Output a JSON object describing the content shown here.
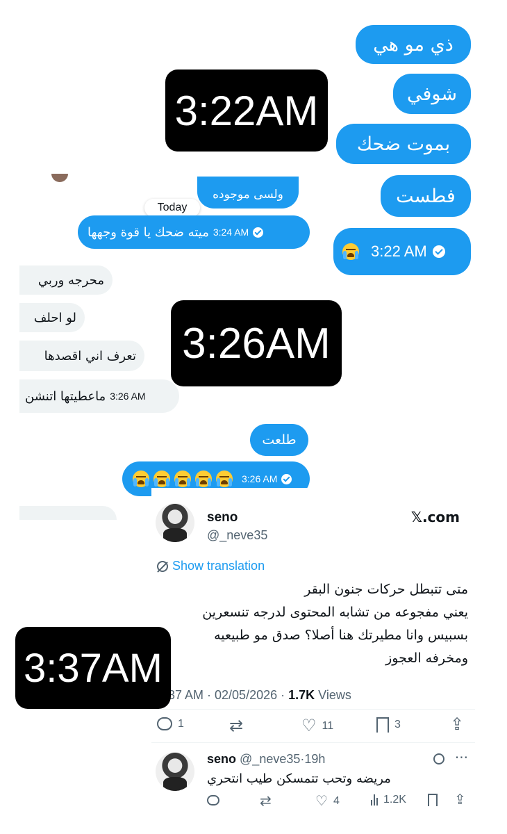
{
  "panel1": {
    "messages": [
      "ذي مو هي",
      "شوفي",
      "بموت ضحك",
      "فطست"
    ],
    "last_time": "3:22 AM",
    "badge": "3:22AM"
  },
  "panel2": {
    "top_partial": "ولسى موجوده",
    "date_label": "Today",
    "out_message": "ميته ضحك يا قوة وجهها",
    "out_time": "3:24 AM",
    "in_messages": [
      "محرجه وربي",
      "لو احلف",
      "تعرف اني اقصدها"
    ],
    "in_last": "ماعطيتها اتنشن",
    "in_last_time": "3:26 AM",
    "out2": "طلعت",
    "emoji_time": "3:26 AM",
    "badge": "3:26AM"
  },
  "tweet": {
    "name": "seno",
    "handle": "@_neve35",
    "brand": "𝕏.com",
    "show_translation": "Show translation",
    "lines": [
      "متى تتبطل حركات جنون البقر",
      "يعني مفجوعه من تشابه المحتوى لدرجه تنسعرين",
      "بسبيس وانا مطيرتك هنا أصلا؟ صدق مو طبيعيه",
      "ومخرفه العجوز"
    ],
    "meta_time": "37 AM · 02/05/2026 · ",
    "views_count": "1.7K",
    "views_label": " Views",
    "replies": "1",
    "likes": "11",
    "bookmarks": "3",
    "badge": "3:37AM"
  },
  "reply": {
    "name": "seno",
    "handle": "@_neve35",
    "age": "·19h",
    "text": "مريضه وتحب تتمسكن طيب انتحري",
    "likes": "4",
    "views": "1.2K"
  }
}
